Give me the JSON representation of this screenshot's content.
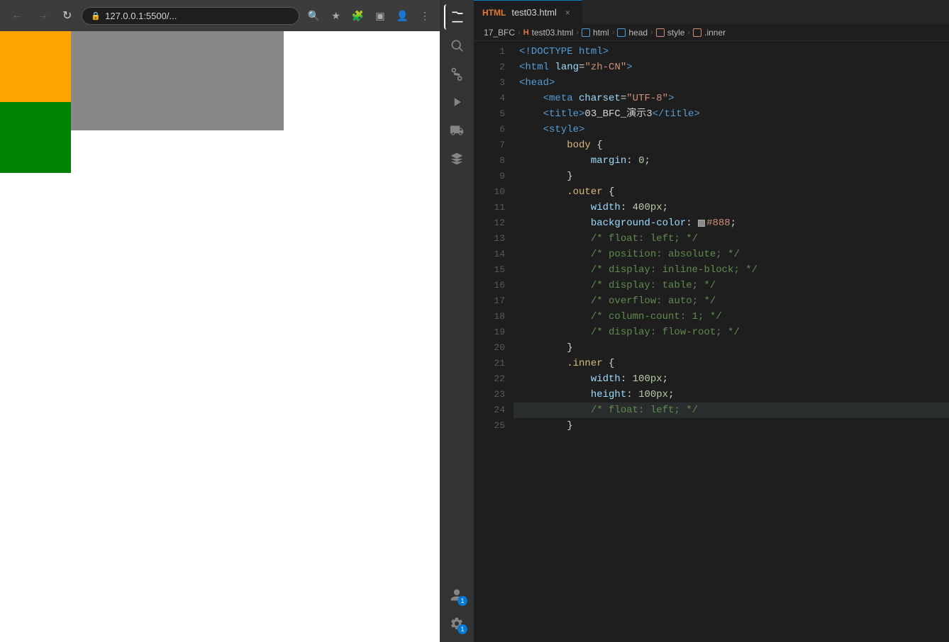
{
  "browser": {
    "back_label": "←",
    "forward_label": "→",
    "refresh_label": "↻",
    "address": "127.0.0.1:5500/...",
    "toolbar_icons": [
      "🔍",
      "⭮",
      "★",
      "🧩",
      "⬜",
      "👤",
      "⋮"
    ]
  },
  "activity_bar": {
    "icons": [
      {
        "name": "files",
        "symbol": "⧉",
        "active": true
      },
      {
        "name": "search",
        "symbol": "🔍"
      },
      {
        "name": "source-control",
        "symbol": "⑂"
      },
      {
        "name": "run",
        "symbol": "▷"
      },
      {
        "name": "extensions",
        "symbol": "⊞"
      },
      {
        "name": "remote",
        "symbol": "⬡"
      }
    ],
    "bottom_icons": [
      {
        "name": "accounts",
        "symbol": "👤",
        "badge": "1"
      },
      {
        "name": "settings",
        "symbol": "⚙",
        "badge": "1"
      }
    ]
  },
  "editor": {
    "tab_label": "test03.html",
    "breadcrumb": {
      "folder": "17_BFC",
      "file": "test03.html",
      "tag_html": "html",
      "tag_head": "head",
      "tag_style": "style",
      "class_inner": ".inner"
    },
    "lines": [
      {
        "num": 1,
        "tokens": [
          {
            "t": "doctype",
            "v": "<!DOCTYPE html>"
          }
        ]
      },
      {
        "num": 2,
        "tokens": [
          {
            "t": "tag",
            "v": "<html"
          },
          {
            "t": "attr-name",
            "v": " lang"
          },
          {
            "t": "punct",
            "v": "="
          },
          {
            "t": "attr-value",
            "v": "\"zh-CN\""
          },
          {
            "t": "tag",
            "v": ">"
          }
        ]
      },
      {
        "num": 3,
        "tokens": [
          {
            "t": "tag",
            "v": "<head>"
          }
        ]
      },
      {
        "num": 4,
        "tokens": [
          {
            "t": "text",
            "v": "    "
          },
          {
            "t": "tag",
            "v": "<meta"
          },
          {
            "t": "attr-name",
            "v": " charset"
          },
          {
            "t": "punct",
            "v": "="
          },
          {
            "t": "attr-value",
            "v": "\"UTF-8\""
          },
          {
            "t": "tag",
            "v": ">"
          }
        ]
      },
      {
        "num": 5,
        "tokens": [
          {
            "t": "text",
            "v": "    "
          },
          {
            "t": "tag",
            "v": "<title>"
          },
          {
            "t": "text",
            "v": "03_BFC_演示3"
          },
          {
            "t": "tag",
            "v": "</title>"
          }
        ]
      },
      {
        "num": 6,
        "tokens": [
          {
            "t": "text",
            "v": "    "
          },
          {
            "t": "tag",
            "v": "<style>"
          }
        ]
      },
      {
        "num": 7,
        "tokens": [
          {
            "t": "text",
            "v": "        "
          },
          {
            "t": "selector",
            "v": "body"
          },
          {
            "t": "text",
            "v": " {"
          }
        ]
      },
      {
        "num": 8,
        "tokens": [
          {
            "t": "text",
            "v": "            "
          },
          {
            "t": "property",
            "v": "margin"
          },
          {
            "t": "punct",
            "v": ": "
          },
          {
            "t": "value-num",
            "v": "0"
          },
          {
            "t": "punct",
            "v": ";"
          }
        ]
      },
      {
        "num": 9,
        "tokens": [
          {
            "t": "text",
            "v": "        }"
          }
        ]
      },
      {
        "num": 10,
        "tokens": [
          {
            "t": "text",
            "v": "        "
          },
          {
            "t": "selector",
            "v": ".outer"
          },
          {
            "t": "text",
            "v": " {"
          }
        ]
      },
      {
        "num": 11,
        "tokens": [
          {
            "t": "text",
            "v": "            "
          },
          {
            "t": "property",
            "v": "width"
          },
          {
            "t": "punct",
            "v": ": "
          },
          {
            "t": "value-num",
            "v": "400px"
          },
          {
            "t": "punct",
            "v": ";"
          }
        ]
      },
      {
        "num": 12,
        "tokens": [
          {
            "t": "text",
            "v": "            "
          },
          {
            "t": "property",
            "v": "background-color"
          },
          {
            "t": "punct",
            "v": ": "
          },
          {
            "t": "swatch",
            "v": "#888"
          },
          {
            "t": "value",
            "v": "#888"
          },
          {
            "t": "punct",
            "v": ";"
          }
        ]
      },
      {
        "num": 13,
        "tokens": [
          {
            "t": "comment",
            "v": "            /* float: left; */"
          }
        ]
      },
      {
        "num": 14,
        "tokens": [
          {
            "t": "comment",
            "v": "            /* position: absolute; */"
          }
        ]
      },
      {
        "num": 15,
        "tokens": [
          {
            "t": "comment",
            "v": "            /* display: inline-block; */"
          }
        ]
      },
      {
        "num": 16,
        "tokens": [
          {
            "t": "comment",
            "v": "            /* display: table; */"
          }
        ]
      },
      {
        "num": 17,
        "tokens": [
          {
            "t": "comment",
            "v": "            /* overflow: auto; */"
          }
        ]
      },
      {
        "num": 18,
        "tokens": [
          {
            "t": "comment",
            "v": "            /* column-count: 1; */"
          }
        ]
      },
      {
        "num": 19,
        "tokens": [
          {
            "t": "comment",
            "v": "            /* display: flow-root; */"
          }
        ]
      },
      {
        "num": 20,
        "tokens": [
          {
            "t": "text",
            "v": "        }"
          }
        ]
      },
      {
        "num": 21,
        "tokens": [
          {
            "t": "text",
            "v": "        "
          },
          {
            "t": "selector",
            "v": ".inner"
          },
          {
            "t": "text",
            "v": " {"
          }
        ]
      },
      {
        "num": 22,
        "tokens": [
          {
            "t": "text",
            "v": "            "
          },
          {
            "t": "property",
            "v": "width"
          },
          {
            "t": "punct",
            "v": ": "
          },
          {
            "t": "value-num",
            "v": "100px"
          },
          {
            "t": "punct",
            "v": ";"
          }
        ]
      },
      {
        "num": 23,
        "tokens": [
          {
            "t": "text",
            "v": "            "
          },
          {
            "t": "property",
            "v": "height"
          },
          {
            "t": "punct",
            "v": ": "
          },
          {
            "t": "value-num",
            "v": "100px"
          },
          {
            "t": "punct",
            "v": ";"
          }
        ]
      },
      {
        "num": 24,
        "tokens": [
          {
            "t": "comment",
            "v": "            /* float: left; */"
          }
        ]
      },
      {
        "num": 25,
        "tokens": [
          {
            "t": "text",
            "v": "        }"
          }
        ]
      }
    ]
  }
}
